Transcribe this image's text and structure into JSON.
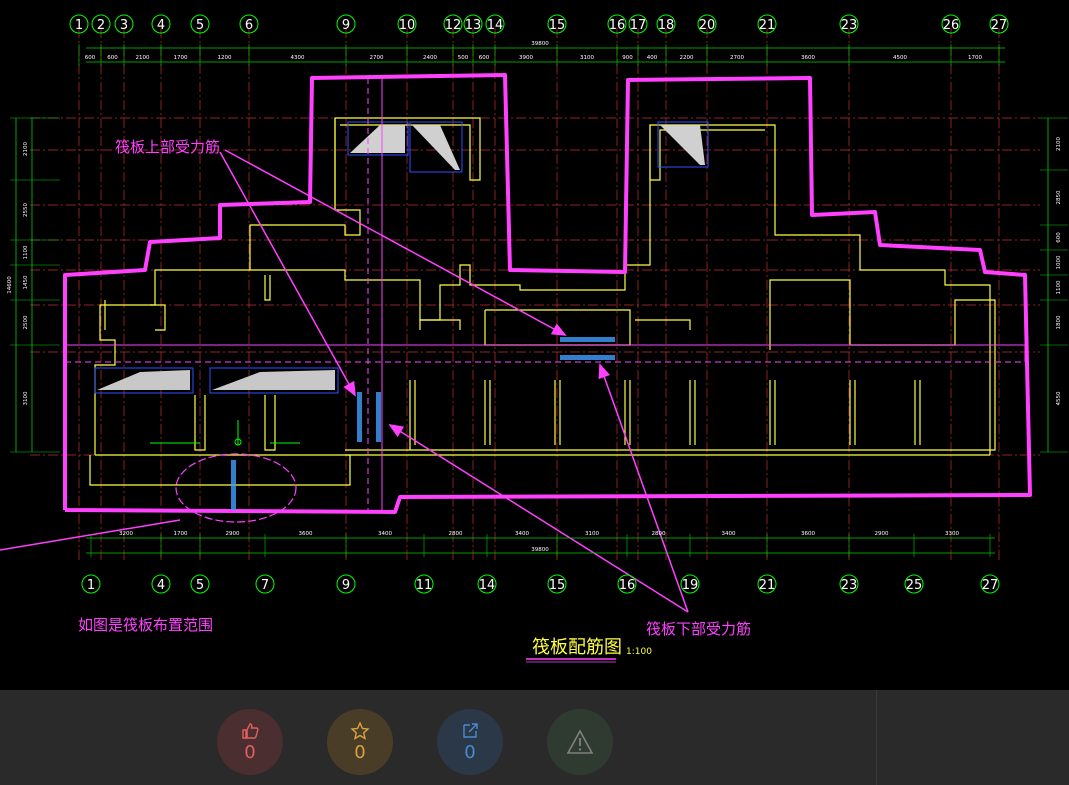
{
  "drawing": {
    "title": "筏板配筋图",
    "scale": "1:100",
    "annotations": {
      "top_rebar": "筏板上部受力筋",
      "bottom_rebar": "筏板下部受力筋",
      "range_note": "如图是筏板布置范围"
    },
    "top_axes": [
      "1",
      "2",
      "3",
      "4",
      "5",
      "6",
      "9",
      "10",
      "12",
      "13",
      "14",
      "15",
      "16",
      "17",
      "18",
      "20",
      "21",
      "23",
      "26",
      "27"
    ],
    "bottom_axes": [
      "1",
      "4",
      "5",
      "7",
      "9",
      "11",
      "14",
      "15",
      "16",
      "19",
      "21",
      "23",
      "25",
      "27"
    ],
    "top_dims": [
      "600",
      "600",
      "2100",
      "1700",
      "1200",
      "4300",
      "2700",
      "2400",
      "500",
      "600",
      "3900",
      "3100",
      "900",
      "400",
      "2200",
      "2700",
      "3600",
      "4500",
      "1700"
    ],
    "top_total": "39800",
    "bottom_dims": [
      "3200",
      "1700",
      "2900",
      "3600",
      "3400",
      "2800",
      "3400",
      "3100",
      "2800",
      "3400",
      "3600",
      "2900",
      "3300"
    ],
    "bottom_total": "39800",
    "left_dims": [
      "2100",
      "2550",
      "1100",
      "1450",
      "2500",
      "3100"
    ],
    "left_total": "14600",
    "right_dims": [
      "2100",
      "2850",
      "600",
      "1000",
      "1100",
      "1800",
      "4550"
    ],
    "colors": {
      "axis": "#00ff00",
      "wall": "#ffff40",
      "highlight": "#ff40ff",
      "rebar_text": "#3fa0ff",
      "grid_red": "#c03030",
      "dim": "#00d000"
    }
  },
  "actions": {
    "like": {
      "icon": "thumbs-up-icon",
      "count": "0",
      "color": "#e06060"
    },
    "favorite": {
      "icon": "star-icon",
      "count": "0",
      "color": "#d9a040"
    },
    "share": {
      "icon": "share-icon",
      "count": "0",
      "color": "#4a8ad0"
    },
    "report": {
      "icon": "warning-icon",
      "color": "#707070"
    }
  }
}
